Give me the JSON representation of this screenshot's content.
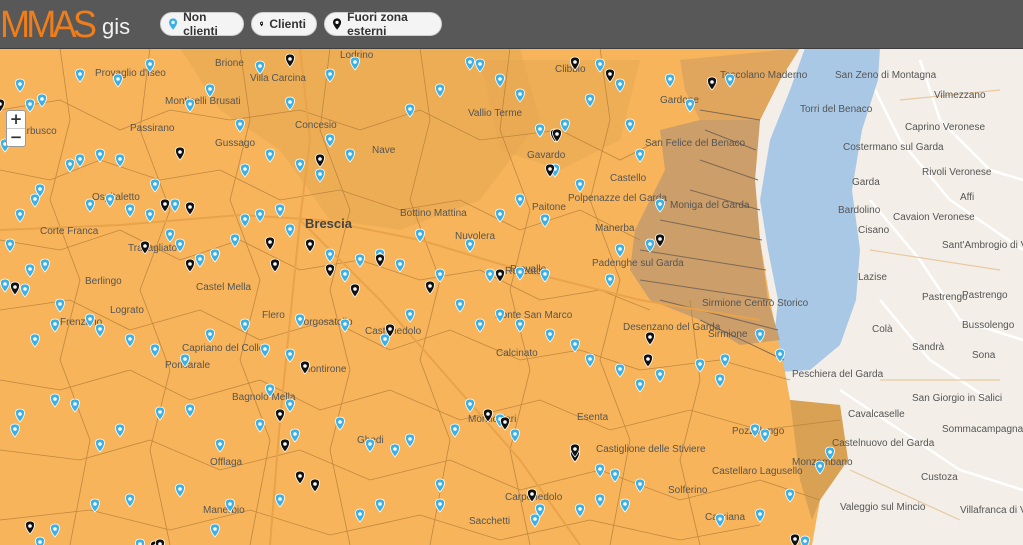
{
  "header": {
    "logo_main": "MMAS",
    "logo_sub": "gis",
    "filters": [
      {
        "label": "Non clienti",
        "icon": "pin-blue-icon"
      },
      {
        "label": "Clienti",
        "icon": "pin-black-icon"
      },
      {
        "label": "Fuori zona esterni",
        "icon": "pin-black-icon"
      }
    ]
  },
  "map": {
    "zoom_in": "+",
    "zoom_out": "−",
    "colors": {
      "zone": "#f7b45a",
      "outside": "#c49a6c",
      "lake": "#a9c8e6",
      "land": "#f3efe8",
      "pin_blue": "#3bb1e6",
      "pin_black": "#111111"
    },
    "places": [
      "Brione",
      "Villa Carcina",
      "Lodrino",
      "Monticelli Brusati",
      "Provaglio d'Iseo",
      "Erbusco",
      "Passirano",
      "Gussago",
      "Concesio",
      "Vallio Terme",
      "Nave",
      "Gavardo",
      "San Felice del Benaco",
      "Castello",
      "Polpenazze del Garda",
      "Moniga del Garda",
      "Manerba",
      "Ospitaletto",
      "Travagliato",
      "Berlingo",
      "Castel Mella",
      "Lograto",
      "Brescia",
      "Bottino Mattina",
      "Nuvolera",
      "Paitone",
      "Prevalle",
      "Padenghe sul Garda",
      "Flero",
      "Borgosatollo",
      "Castenedolo",
      "Ponte San Marco",
      "Calcinato",
      "Desenzano del Garda",
      "Sirmione",
      "Sirmione Centro Storico",
      "Capriano del Colle",
      "Poncarale",
      "Montirone",
      "Bagnolo Mella",
      "Ghedi",
      "Montichiari",
      "Esenta",
      "Castiglione delle Stiviere",
      "Pozzolengo",
      "Offlaga",
      "Manerbio",
      "Carpenedolo",
      "Castellaro Lagusello",
      "Solferino",
      "Sacchetti",
      "Monzambano",
      "Cavriana",
      "Peschiera del Garda",
      "Cavalcaselle",
      "San Giorgio in Salici",
      "Sommacampagna",
      "Castelnuovo del Garda",
      "Custoza",
      "Valeggio sul Mincio",
      "Villafranca di Verona",
      "Bussolengo",
      "Pastrengo",
      "Sona",
      "Colà",
      "Sandrà",
      "Lazise",
      "Bardolino",
      "Garda",
      "Costermano sul Garda",
      "Cavaion Veronese",
      "Sant'Ambrogio di Valpolicella",
      "Rivoli Veronese",
      "Caprino Veronese",
      "Affi",
      "Torri del Benaco",
      "San Zeno di Montagna",
      "Pastrengo",
      "Toscolano Maderno",
      "Vilmezzano",
      "Cisano",
      "Clibbio",
      "Gardone",
      "Frenzano",
      "Rezzato",
      "Corte Franca"
    ]
  }
}
